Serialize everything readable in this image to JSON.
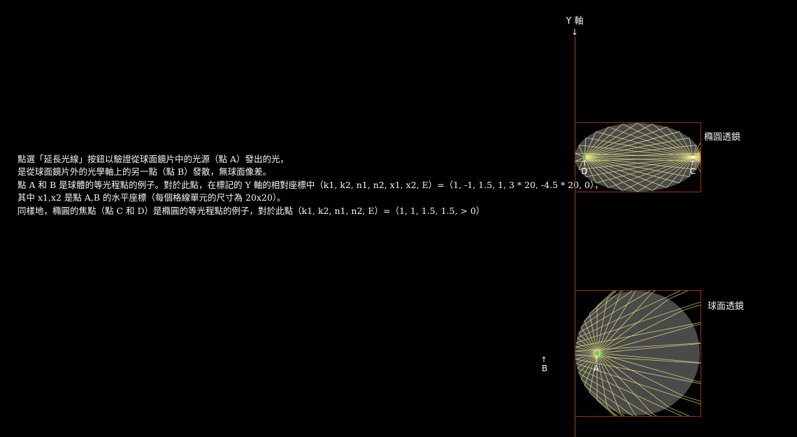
{
  "description": {
    "lines": [
      "點選「延長光線」按鈕以驗證從球面鏡片中的光源（點 A）發出的光，",
      "是從球面鏡片外的光學軸上的另一點（點 B）發散，無球面像差。",
      "點 A 和 B 是球體的等光程點的例子。對於此點，在標記的 Y 軸的相對座標中（k1, k2, n1, n2, x1, x2, E）=（1, -1, 1.5, 1, 3 * 20, -4.5 * 20, 0），",
      "其中 x1,x2 是點 A,B 的水平座標（每個格線單元的尺寸為 20x20）。",
      "同樣地，橢圓的焦點（點 C 和 D）是橢圓的等光程點的例子，對於此點（k1, k2, n1, n2, E）=（1, 1, 1.5, 1.5, > 0）"
    ]
  },
  "axis": {
    "label": "Y 軸",
    "arrow": "↓"
  },
  "ellipse_lens": {
    "label": "橢圓透鏡",
    "point_c": "C",
    "point_d": "D",
    "arrow": "↑"
  },
  "sphere_lens": {
    "label": "球面透鏡",
    "point_a": "A",
    "point_b": "B",
    "arrow": "↑"
  },
  "colors": {
    "background": "#000000",
    "axis_line": "#8a3a1c",
    "frame": "#8a3a1c",
    "lens_fill": "#4a4a4a",
    "ray": "#f3f08a",
    "source": "#58d64a"
  }
}
